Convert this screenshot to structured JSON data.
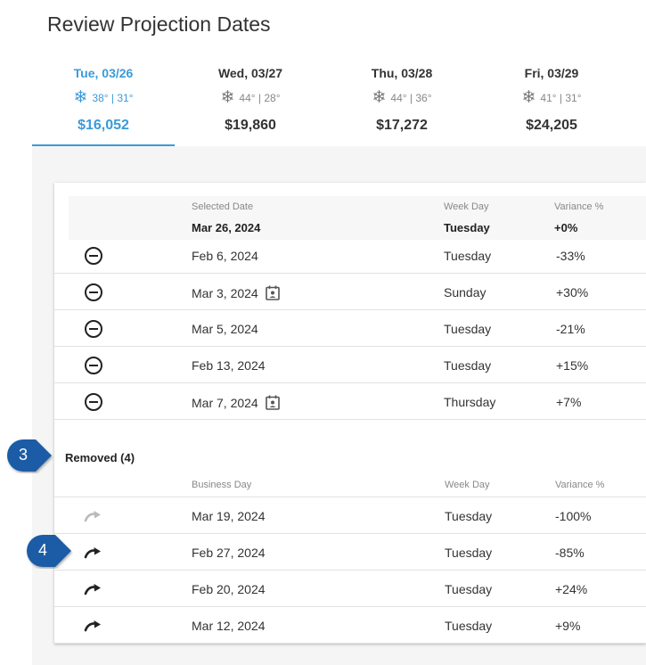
{
  "page_title": "Review Projection Dates",
  "day_tabs": [
    {
      "label": "Tue, 03/26",
      "weather": "38° | 31°",
      "amount": "$16,052",
      "active": true
    },
    {
      "label": "Wed, 03/27",
      "weather": "44° | 28°",
      "amount": "$19,860",
      "active": false
    },
    {
      "label": "Thu, 03/28",
      "weather": "44° | 36°",
      "amount": "$17,272",
      "active": false
    },
    {
      "label": "Fri, 03/29",
      "weather": "41° | 31°",
      "amount": "$24,205",
      "active": false
    }
  ],
  "weather_icon": "snowflake-icon",
  "selected": {
    "date_header": "Selected Date",
    "weekday_header": "Week Day",
    "variance_header": "Variance %",
    "date": "Mar 26, 2024",
    "weekday": "Tuesday",
    "variance": "+0%"
  },
  "included_rows": [
    {
      "date": "Feb 6, 2024",
      "weekday": "Tuesday",
      "variance": "-33%",
      "calendar_icon": false
    },
    {
      "date": "Mar 3, 2024",
      "weekday": "Sunday",
      "variance": "+30%",
      "calendar_icon": true
    },
    {
      "date": "Mar 5, 2024",
      "weekday": "Tuesday",
      "variance": "-21%",
      "calendar_icon": false
    },
    {
      "date": "Feb 13, 2024",
      "weekday": "Tuesday",
      "variance": "+15%",
      "calendar_icon": false
    },
    {
      "date": "Mar 7, 2024",
      "weekday": "Thursday",
      "variance": "+7%",
      "calendar_icon": true
    }
  ],
  "removed": {
    "title": "Removed (4)",
    "date_header": "Business Day",
    "weekday_header": "Week Day",
    "variance_header": "Variance %",
    "rows": [
      {
        "date": "Mar 19, 2024",
        "weekday": "Tuesday",
        "variance": "-100%",
        "disabled": true
      },
      {
        "date": "Feb 27, 2024",
        "weekday": "Tuesday",
        "variance": "-85%",
        "disabled": false
      },
      {
        "date": "Feb 20, 2024",
        "weekday": "Tuesday",
        "variance": "+24%",
        "disabled": false
      },
      {
        "date": "Mar 12, 2024",
        "weekday": "Tuesday",
        "variance": "+9%",
        "disabled": false
      }
    ]
  },
  "callouts": [
    "3",
    "4"
  ],
  "colors": {
    "accent": "#3a9ad9",
    "callout": "#1a5ba6"
  }
}
